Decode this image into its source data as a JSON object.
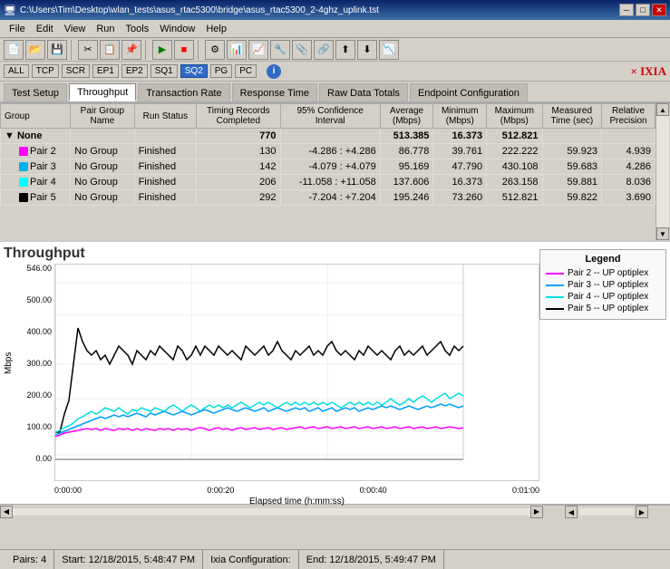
{
  "titlebar": {
    "title": "C:\\Users\\Tim\\Desktop\\wlan_tests\\asus_rtac5300\\bridge\\asus_rtac5300_2-4ghz_uplink.tst",
    "minimize": "─",
    "maximize": "□",
    "close": "✕"
  },
  "menu": {
    "items": [
      "File",
      "Edit",
      "View",
      "Run",
      "Tools",
      "Window",
      "Help"
    ]
  },
  "proto_tabs": {
    "items": [
      "ALL",
      "TCP",
      "SCR",
      "EP1",
      "EP2",
      "SQ1",
      "SQ2",
      "PG",
      "PC"
    ],
    "active": "SQ2"
  },
  "tabs": {
    "items": [
      "Test Setup",
      "Throughput",
      "Transaction Rate",
      "Response Time",
      "Raw Data Totals",
      "Endpoint Configuration"
    ],
    "active": "Throughput"
  },
  "table": {
    "headers": {
      "group": "Group",
      "pair_group_name": "Pair Group Name",
      "run_status": "Run Status",
      "timing_records": "Timing Records Completed",
      "confidence": "95% Confidence Interval",
      "average": "Average (Mbps)",
      "minimum": "Minimum (Mbps)",
      "maximum": "Maximum (Mbps)",
      "measured_time": "Measured Time (sec)",
      "relative_precision": "Relative Precision"
    },
    "rows": [
      {
        "indent": 0,
        "expand": true,
        "color": null,
        "group": "None",
        "pair_group_name": "",
        "run_status": "",
        "timing_records": "770",
        "confidence": "",
        "average": "513.385",
        "minimum": "16.373",
        "maximum": "512.821",
        "measured_time": "",
        "relative_precision": "",
        "bold": true
      },
      {
        "indent": 1,
        "expand": false,
        "color": "#ff00ff",
        "group": "Pair 2",
        "pair_group_name": "No Group",
        "run_status": "Finished",
        "timing_records": "130",
        "confidence": "-4.286 : +4.286",
        "average": "86.778",
        "minimum": "39.761",
        "maximum": "222.222",
        "measured_time": "59.923",
        "relative_precision": "4.939",
        "bold": false
      },
      {
        "indent": 1,
        "expand": false,
        "color": "#00b0f0",
        "group": "Pair 3",
        "pair_group_name": "No Group",
        "run_status": "Finished",
        "timing_records": "142",
        "confidence": "-4.079 : +4.079",
        "average": "95.169",
        "minimum": "47.790",
        "maximum": "430.108",
        "measured_time": "59.683",
        "relative_precision": "4.286",
        "bold": false
      },
      {
        "indent": 1,
        "expand": false,
        "color": "#00ffff",
        "group": "Pair 4",
        "pair_group_name": "No Group",
        "run_status": "Finished",
        "timing_records": "206",
        "confidence": "-11.058 : +11.058",
        "average": "137.606",
        "minimum": "16.373",
        "maximum": "263.158",
        "measured_time": "59.881",
        "relative_precision": "8.036",
        "bold": false
      },
      {
        "indent": 1,
        "expand": false,
        "color": "#000000",
        "group": "Pair 5",
        "pair_group_name": "No Group",
        "run_status": "Finished",
        "timing_records": "292",
        "confidence": "-7.204 : +7.204",
        "average": "195.246",
        "minimum": "73.260",
        "maximum": "512.821",
        "measured_time": "59.822",
        "relative_precision": "3.690",
        "bold": false
      }
    ]
  },
  "chart": {
    "title": "Throughput",
    "y_label": "Mbps",
    "x_label": "Elapsed time (h:mm:ss)",
    "y_ticks": [
      "546.00",
      "500.00",
      "400.00",
      "300.00",
      "200.00",
      "100.00",
      "0.00"
    ],
    "x_ticks": [
      "0:00:00",
      "0:00:20",
      "0:00:40",
      "0:01:00"
    ]
  },
  "legend": {
    "title": "Legend",
    "items": [
      {
        "label": "Pair 2 -- UP optiplex",
        "color": "#ff00ff"
      },
      {
        "label": "Pair 3 -- UP optiplex",
        "color": "#00a0ff"
      },
      {
        "label": "Pair 4 -- UP optiplex",
        "color": "#00e0e0"
      },
      {
        "label": "Pair 5 -- UP optiplex",
        "color": "#000000"
      }
    ]
  },
  "statusbar": {
    "pairs": "Pairs: 4",
    "start": "Start: 12/18/2015, 5:48:47 PM",
    "ixia_config": "Ixia Configuration:",
    "end": "End: 12/18/2015, 5:49:47 PM"
  }
}
